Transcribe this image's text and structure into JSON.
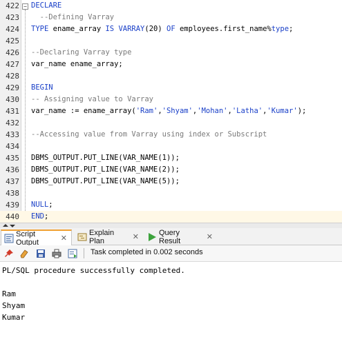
{
  "editor": {
    "lines": [
      {
        "n": "422",
        "segs": [
          {
            "t": "DECLARE",
            "c": "kw"
          }
        ]
      },
      {
        "n": "423",
        "segs": [
          {
            "t": "  --Defining Varray",
            "c": "cm"
          }
        ]
      },
      {
        "n": "424",
        "segs": [
          {
            "t": "TYPE",
            "c": "kw"
          },
          {
            "t": " ename_array ",
            "c": ""
          },
          {
            "t": "IS VARRAY",
            "c": "kw"
          },
          {
            "t": "(20) ",
            "c": ""
          },
          {
            "t": "OF",
            "c": "kw"
          },
          {
            "t": " employees.first_name%",
            "c": ""
          },
          {
            "t": "type",
            "c": "kw"
          },
          {
            "t": ";",
            "c": ""
          }
        ]
      },
      {
        "n": "425",
        "segs": []
      },
      {
        "n": "426",
        "segs": [
          {
            "t": "--Declaring Varray type",
            "c": "cm"
          }
        ]
      },
      {
        "n": "427",
        "segs": [
          {
            "t": "var_name ename_array;",
            "c": ""
          }
        ]
      },
      {
        "n": "428",
        "segs": []
      },
      {
        "n": "429",
        "segs": [
          {
            "t": "BEGIN",
            "c": "kw"
          }
        ]
      },
      {
        "n": "430",
        "segs": [
          {
            "t": "-- Assigning value to Varray",
            "c": "cm"
          }
        ]
      },
      {
        "n": "431",
        "segs": [
          {
            "t": "var_name := ename_array(",
            "c": ""
          },
          {
            "t": "'Ram'",
            "c": "st"
          },
          {
            "t": ",",
            "c": ""
          },
          {
            "t": "'Shyam'",
            "c": "st"
          },
          {
            "t": ",",
            "c": ""
          },
          {
            "t": "'Mohan'",
            "c": "st"
          },
          {
            "t": ",",
            "c": ""
          },
          {
            "t": "'Latha'",
            "c": "st"
          },
          {
            "t": ",",
            "c": ""
          },
          {
            "t": "'Kumar'",
            "c": "st"
          },
          {
            "t": ");",
            "c": ""
          }
        ]
      },
      {
        "n": "432",
        "segs": []
      },
      {
        "n": "433",
        "segs": [
          {
            "t": "--Accessing value from Varray using index or Subscript",
            "c": "cm"
          }
        ]
      },
      {
        "n": "434",
        "segs": []
      },
      {
        "n": "435",
        "segs": [
          {
            "t": "DBMS_OUTPUT.PUT_LINE(VAR_NAME(1));",
            "c": ""
          }
        ]
      },
      {
        "n": "436",
        "segs": [
          {
            "t": "DBMS_OUTPUT.PUT_LINE(VAR_NAME(2));",
            "c": ""
          }
        ]
      },
      {
        "n": "437",
        "segs": [
          {
            "t": "DBMS_OUTPUT.PUT_LINE(VAR_NAME(5));",
            "c": ""
          }
        ]
      },
      {
        "n": "438",
        "segs": []
      },
      {
        "n": "439",
        "segs": [
          {
            "t": "NULL",
            "c": "kw"
          },
          {
            "t": ";",
            "c": ""
          }
        ]
      },
      {
        "n": "440",
        "segs": [
          {
            "t": "END",
            "c": "kw"
          },
          {
            "t": ";",
            "c": ""
          }
        ]
      }
    ],
    "current_line": "440"
  },
  "tabs": [
    {
      "label": "Script Output",
      "icon": "script-output-icon",
      "active": true
    },
    {
      "label": "Explain Plan",
      "icon": "explain-plan-icon",
      "active": false
    },
    {
      "label": "Query Result",
      "icon": "query-result-icon",
      "active": false
    }
  ],
  "toolbar": {
    "status": "Task completed in 0.002 seconds",
    "icons": [
      "pin-icon",
      "eraser-icon",
      "save-icon",
      "print-icon",
      "export-icon"
    ]
  },
  "output": {
    "lines": [
      "PL/SQL procedure successfully completed.",
      "",
      "Ram",
      "Shyam",
      "Kumar"
    ]
  },
  "colors": {
    "keyword": "#1a40c8",
    "comment": "#7a7a7a",
    "active_tab_accent": "#f0a030"
  }
}
